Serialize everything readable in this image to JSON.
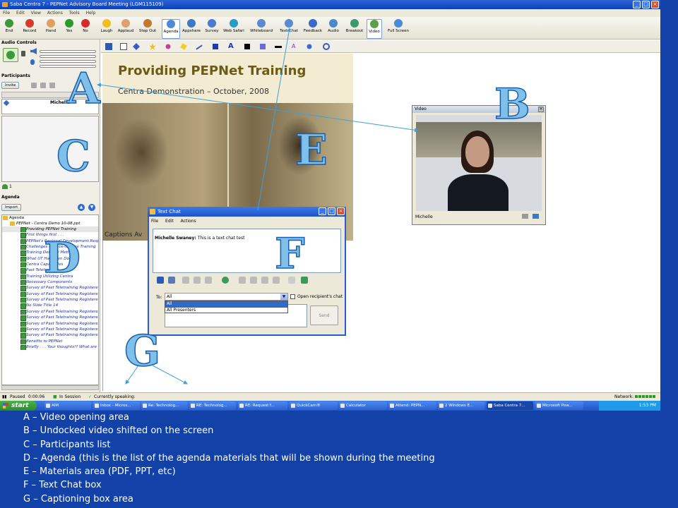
{
  "window": {
    "title": "Saba Centra 7 - PEPNet Advisory Board Meeting (LGM115109)",
    "menus": [
      "File",
      "Edit",
      "View",
      "Actions",
      "Tools",
      "Help"
    ]
  },
  "toolbar": {
    "buttons": [
      {
        "label": "End",
        "color": "#3a9a3a"
      },
      {
        "label": "Record",
        "color": "#d83a2a"
      },
      {
        "label": "Hand",
        "color": "#e0a060"
      },
      {
        "label": "Yes",
        "color": "#2a9a2a"
      },
      {
        "label": "No",
        "color": "#d82a2a"
      },
      {
        "label": "Laugh",
        "color": "#f0c020"
      },
      {
        "label": "Applaud",
        "color": "#e0a070"
      },
      {
        "label": "Step Out",
        "color": "#c07a30"
      },
      {
        "label": "Agenda",
        "color": "#4a8ad8"
      },
      {
        "label": "Appshare",
        "color": "#3a7ac8"
      },
      {
        "label": "Survey",
        "color": "#4a7ad0"
      },
      {
        "label": "Web Safari",
        "color": "#2a9ac8"
      },
      {
        "label": "Whiteboard",
        "color": "#5a8ad0"
      },
      {
        "label": "Text Chat",
        "color": "#5a8ad0"
      },
      {
        "label": "Feedback",
        "color": "#3a6ac8"
      },
      {
        "label": "Audio",
        "color": "#4a8ac8"
      },
      {
        "label": "Breakout",
        "color": "#3a9a6a"
      },
      {
        "label": "Video",
        "color": "#5aa04a"
      },
      {
        "label": "Full Screen",
        "color": "#4a8ad8"
      }
    ]
  },
  "left_panel": {
    "audio_controls": "Audio Controls",
    "participants": "Participants",
    "invite": "Invite",
    "participant_name": "Michelle",
    "participant_count": "1",
    "agenda_header": "Agenda",
    "import": "Import",
    "agenda_root": "Agenda",
    "agenda_file": "PEPNet - Centra Demo 10-08.ppt",
    "agenda_items": [
      "Providing PEPNet Training",
      "First things first . . .",
      "PEPNet's Regional Development Respo...",
      "Challenges to Face-to-Face Training",
      "Training Delivery Methods",
      "What UT Has Been Doing",
      "Centra Capabilities",
      "Past Teletraining",
      "Training Utilizing Centra",
      "Necessary Components",
      "Survey of Past Teletraining Registered",
      "Survey of Past Teletraining Registered",
      "Survey of Past Teletraining Registered",
      "No Slide Title 14",
      "Survey of Past Teletraining Registered",
      "Survey of Past Teletraining Registered",
      "Survey of Past Teletraining Registered",
      "Survey of Past Teletraining Registered",
      "Survey of Past Teletraining Registered",
      "Benefits to PEPNet",
      "Briefly . . . Your thoughts!? What are t..."
    ]
  },
  "slide": {
    "title": "Providing PEPNet Training",
    "subtitle": "Centra Demonstration – October, 2008",
    "captions": "Captions Av"
  },
  "video_window": {
    "title": "Video",
    "name": "Michelle"
  },
  "chat_window": {
    "title": "Text Chat",
    "menus": [
      "File",
      "Edit",
      "Actions"
    ],
    "sender": "Michelle Swaney:",
    "message": "This is a text chat test",
    "to_label": "To:",
    "to_value": "All",
    "options": [
      "All",
      "All Presenters"
    ],
    "open_chat": "Open recipient's chat",
    "send": "Send"
  },
  "status": {
    "paused": "Paused",
    "time": "0:00:06",
    "session": "In Session",
    "speaking": "Currently speaking:",
    "network": "Network:"
  },
  "taskbar": {
    "start": "start",
    "tasks": [
      "AIM",
      "Inbox - Micros...",
      "Re: Technolog...",
      "RE: Technolog...",
      "RE: Request f...",
      "QuickCam®",
      "Calculator",
      "Attend: PEPN...",
      "2 Windows E...",
      "Saba Centra 7...",
      "Microsoft Pow..."
    ],
    "clock": "1:53 PM"
  },
  "annotations": {
    "letters": [
      "A",
      "B",
      "C",
      "D",
      "E",
      "F",
      "G"
    ]
  },
  "legend": [
    "A – Video opening area",
    "B – Undocked video shifted on the screen",
    "C – Participants list",
    "D – Agenda (this is the list of the agenda materials that will be shown during the meeting",
    "E – Materials area (PDF, PPT, etc)",
    "F – Text Chat box",
    "G – Captioning box area"
  ]
}
